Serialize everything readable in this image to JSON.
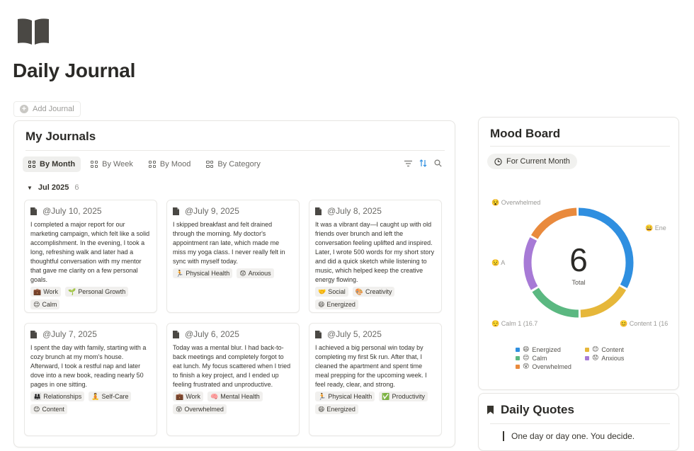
{
  "page": {
    "title": "Daily Journal",
    "add_label": "Add Journal",
    "icon": "book-icon"
  },
  "journals": {
    "title": "My Journals",
    "views": [
      {
        "label": "By Month",
        "active": true
      },
      {
        "label": "By Week",
        "active": false
      },
      {
        "label": "By Mood",
        "active": false
      },
      {
        "label": "By Category",
        "active": false
      }
    ],
    "group": {
      "name": "Jul 2025",
      "count": "6"
    },
    "entries": [
      {
        "date": "@July 10, 2025",
        "text": "I completed a major report for our marketing campaign, which felt like a solid accomplishment. In the evening, I took a long, refreshing walk and later had a thoughtful conversation with my mentor that gave me clarity on a few personal goals.",
        "tags": [
          {
            "emoji": "💼",
            "label": "Work"
          },
          {
            "emoji": "🌱",
            "label": "Personal Growth"
          },
          {
            "emoji": "😌",
            "label": "Calm"
          }
        ]
      },
      {
        "date": "@July 9, 2025",
        "text": "I skipped breakfast and felt drained through the morning. My doctor's appointment ran late, which made me miss my yoga class. I never really felt in sync with myself today.",
        "tags": [
          {
            "emoji": "🏃",
            "label": "Physical Health"
          },
          {
            "emoji": "😟",
            "label": "Anxious"
          }
        ]
      },
      {
        "date": "@July 8, 2025",
        "text": "It was a vibrant day—I caught up with old friends over brunch and left the conversation feeling uplifted and inspired. Later, I wrote 500 words for my short story and did a quick sketch while listening to music, which helped keep the creative energy flowing.",
        "tags": [
          {
            "emoji": "🤝",
            "label": "Social"
          },
          {
            "emoji": "🎨",
            "label": "Creativity"
          },
          {
            "emoji": "😄",
            "label": "Energized"
          }
        ]
      },
      {
        "date": "@July 7, 2025",
        "text": "I spent the day with family, starting with a cozy brunch at my mom's house. Afterward, I took a restful nap and later dove into a new book, reading nearly 50 pages in one sitting.",
        "tags": [
          {
            "emoji": "👨‍👩‍👧",
            "label": "Relationships"
          },
          {
            "emoji": "🧘",
            "label": "Self-Care"
          },
          {
            "emoji": "😊",
            "label": "Content"
          }
        ]
      },
      {
        "date": "@July 6, 2025",
        "text": "Today was a mental blur. I had back-to-back meetings and completely forgot to eat lunch. My focus scattered when I tried to finish a key project, and I ended up feeling frustrated and unproductive.",
        "tags": [
          {
            "emoji": "💼",
            "label": "Work"
          },
          {
            "emoji": "🧠",
            "label": "Mental Health"
          },
          {
            "emoji": "😵",
            "label": "Overwhelmed"
          }
        ]
      },
      {
        "date": "@July 5, 2025",
        "text": "I achieved a big personal win today by completing my first 5k run. After that, I cleaned the apartment and spent time meal prepping for the upcoming week. I feel ready, clear, and strong.",
        "tags": [
          {
            "emoji": "🏃",
            "label": "Physical Health"
          },
          {
            "emoji": "✅",
            "label": "Productivity"
          },
          {
            "emoji": "😄",
            "label": "Energized"
          }
        ]
      }
    ]
  },
  "mood_board": {
    "title": "Mood Board",
    "filter": "For Current Month",
    "total_value": "6",
    "total_label": "Total",
    "slice_labels": {
      "overwhelmed": "😵 Overwhelmed",
      "energized": "😄 Ene",
      "anxious": "😟 A",
      "calm": "😌 Calm  1 (16.7",
      "content": "😊 Content  1 (16"
    }
  },
  "chart_data": {
    "type": "pie",
    "categories": [
      "Energized",
      "Content",
      "Calm",
      "Anxious",
      "Overwhelmed"
    ],
    "values": [
      2,
      1,
      1,
      1,
      1
    ],
    "colors": [
      "#2f8fe0",
      "#e6b73a",
      "#5bb881",
      "#a77ad6",
      "#e98a3d"
    ],
    "legend": [
      {
        "emoji": "😄",
        "label": "Energized"
      },
      {
        "emoji": "😊",
        "label": "Content"
      },
      {
        "emoji": "😌",
        "label": "Calm"
      },
      {
        "emoji": "😟",
        "label": "Anxious"
      },
      {
        "emoji": "😵",
        "label": "Overwhelmed"
      }
    ],
    "legend_placement": "bottom"
  },
  "quotes": {
    "title": "Daily Quotes",
    "text": "One day or day one. You decide."
  }
}
